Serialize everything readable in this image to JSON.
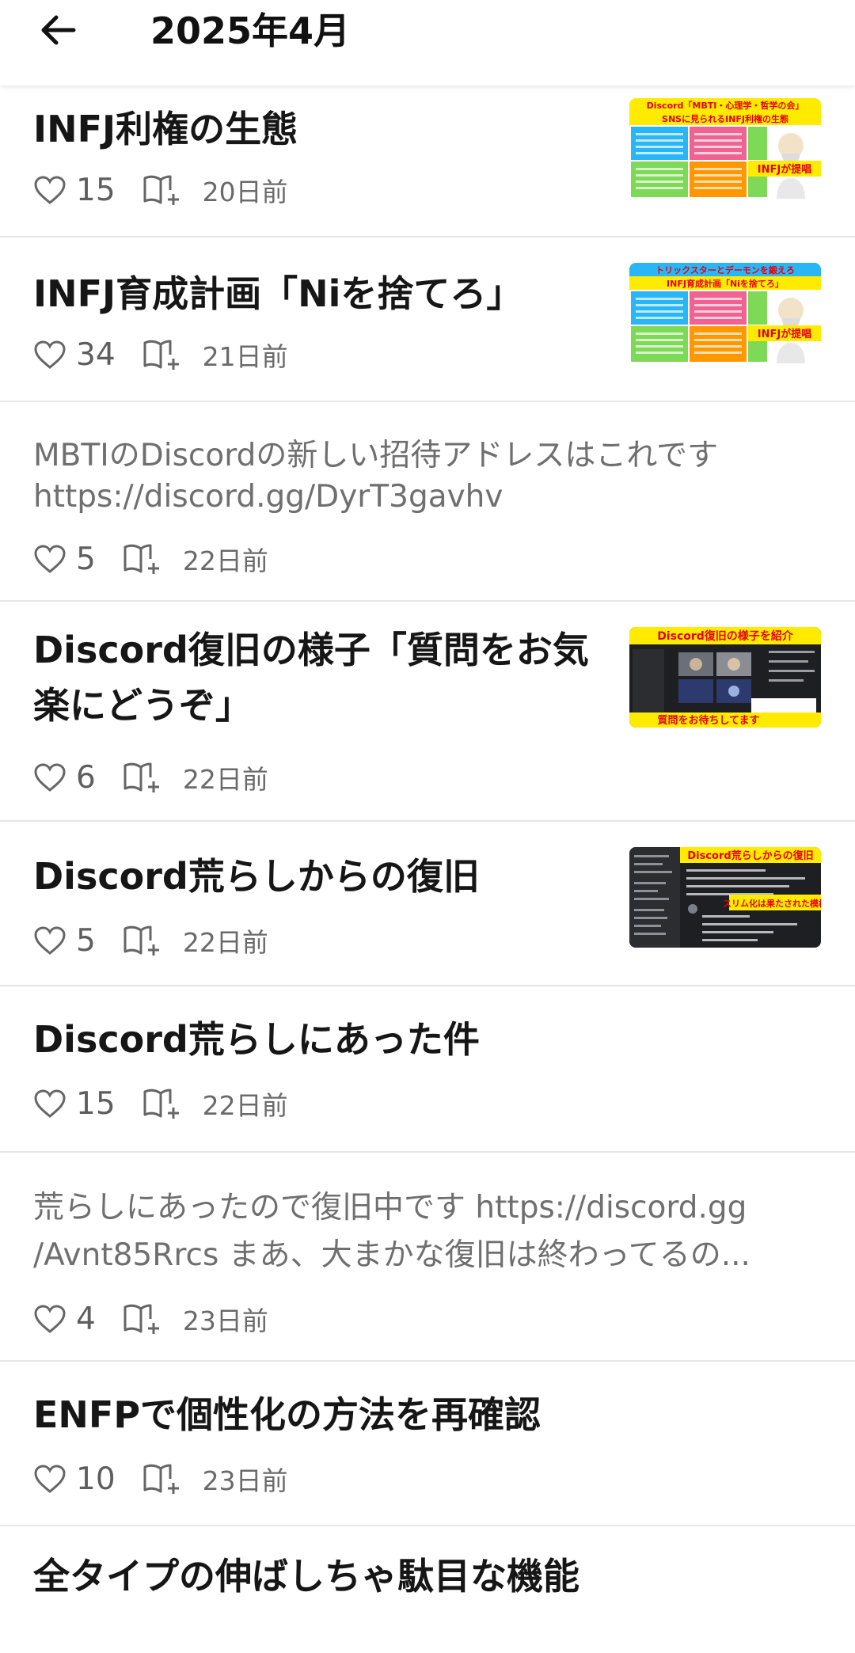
{
  "header": {
    "title": "2025年4月"
  },
  "posts": [
    {
      "title": "INFJ利権の生態",
      "likes": "15",
      "date": "20日前",
      "thumb": {
        "top": "Discord「MBTI・心理学・哲学の会」",
        "sub": "SNSに見られるINFJ利権の生態",
        "badge": "INFJが提唱"
      }
    },
    {
      "title": "INFJ育成計画「Niを捨てろ」",
      "likes": "34",
      "date": "21日前",
      "thumb": {
        "top": "トリックスターとデーモンを鍛えろ",
        "sub": "INFJ育成計画「Niを捨てろ」",
        "badge": "INFJが提唱"
      }
    },
    {
      "excerpt": [
        "MBTIのDiscordの新しい招待アドレスはこれです",
        "https://discord.gg/DyrT3gavhv"
      ],
      "likes": "5",
      "date": "22日前"
    },
    {
      "title": "Discord復旧の様子「質問をお気楽にどうぞ」",
      "likes": "6",
      "date": "22日前",
      "thumb": {
        "top": "Discord復旧の様子を紹介",
        "bottom": "質問をお待ちしてます"
      }
    },
    {
      "title": "Discord荒らしからの復旧",
      "likes": "5",
      "date": "22日前",
      "thumb": {
        "top": "Discord荒らしからの復旧",
        "mid": "スリム化は果たされた模様"
      }
    },
    {
      "title": "Discord荒らしにあった件",
      "likes": "15",
      "date": "22日前"
    },
    {
      "excerpt": [
        "荒らしにあったので復旧中です https://discord.gg",
        "/Avnt85Rrcs まあ、大まかな復旧は終わってるの..."
      ],
      "likes": "4",
      "date": "23日前"
    },
    {
      "title": "ENFPで個性化の方法を再確認",
      "likes": "10",
      "date": "23日前"
    },
    {
      "title": "全タイプの伸ばしちゃ駄目な機能"
    }
  ],
  "colors": {
    "yellow": "#ffeb00",
    "red": "#e60012",
    "cyan": "#29b6f6",
    "pink": "#f06292",
    "green": "#7ed957",
    "orange": "#ff9800",
    "dark": "#1e1f22"
  },
  "icons": {
    "back": "arrow-left-icon",
    "like": "heart-outline-icon",
    "bookmark": "book-plus-icon"
  }
}
